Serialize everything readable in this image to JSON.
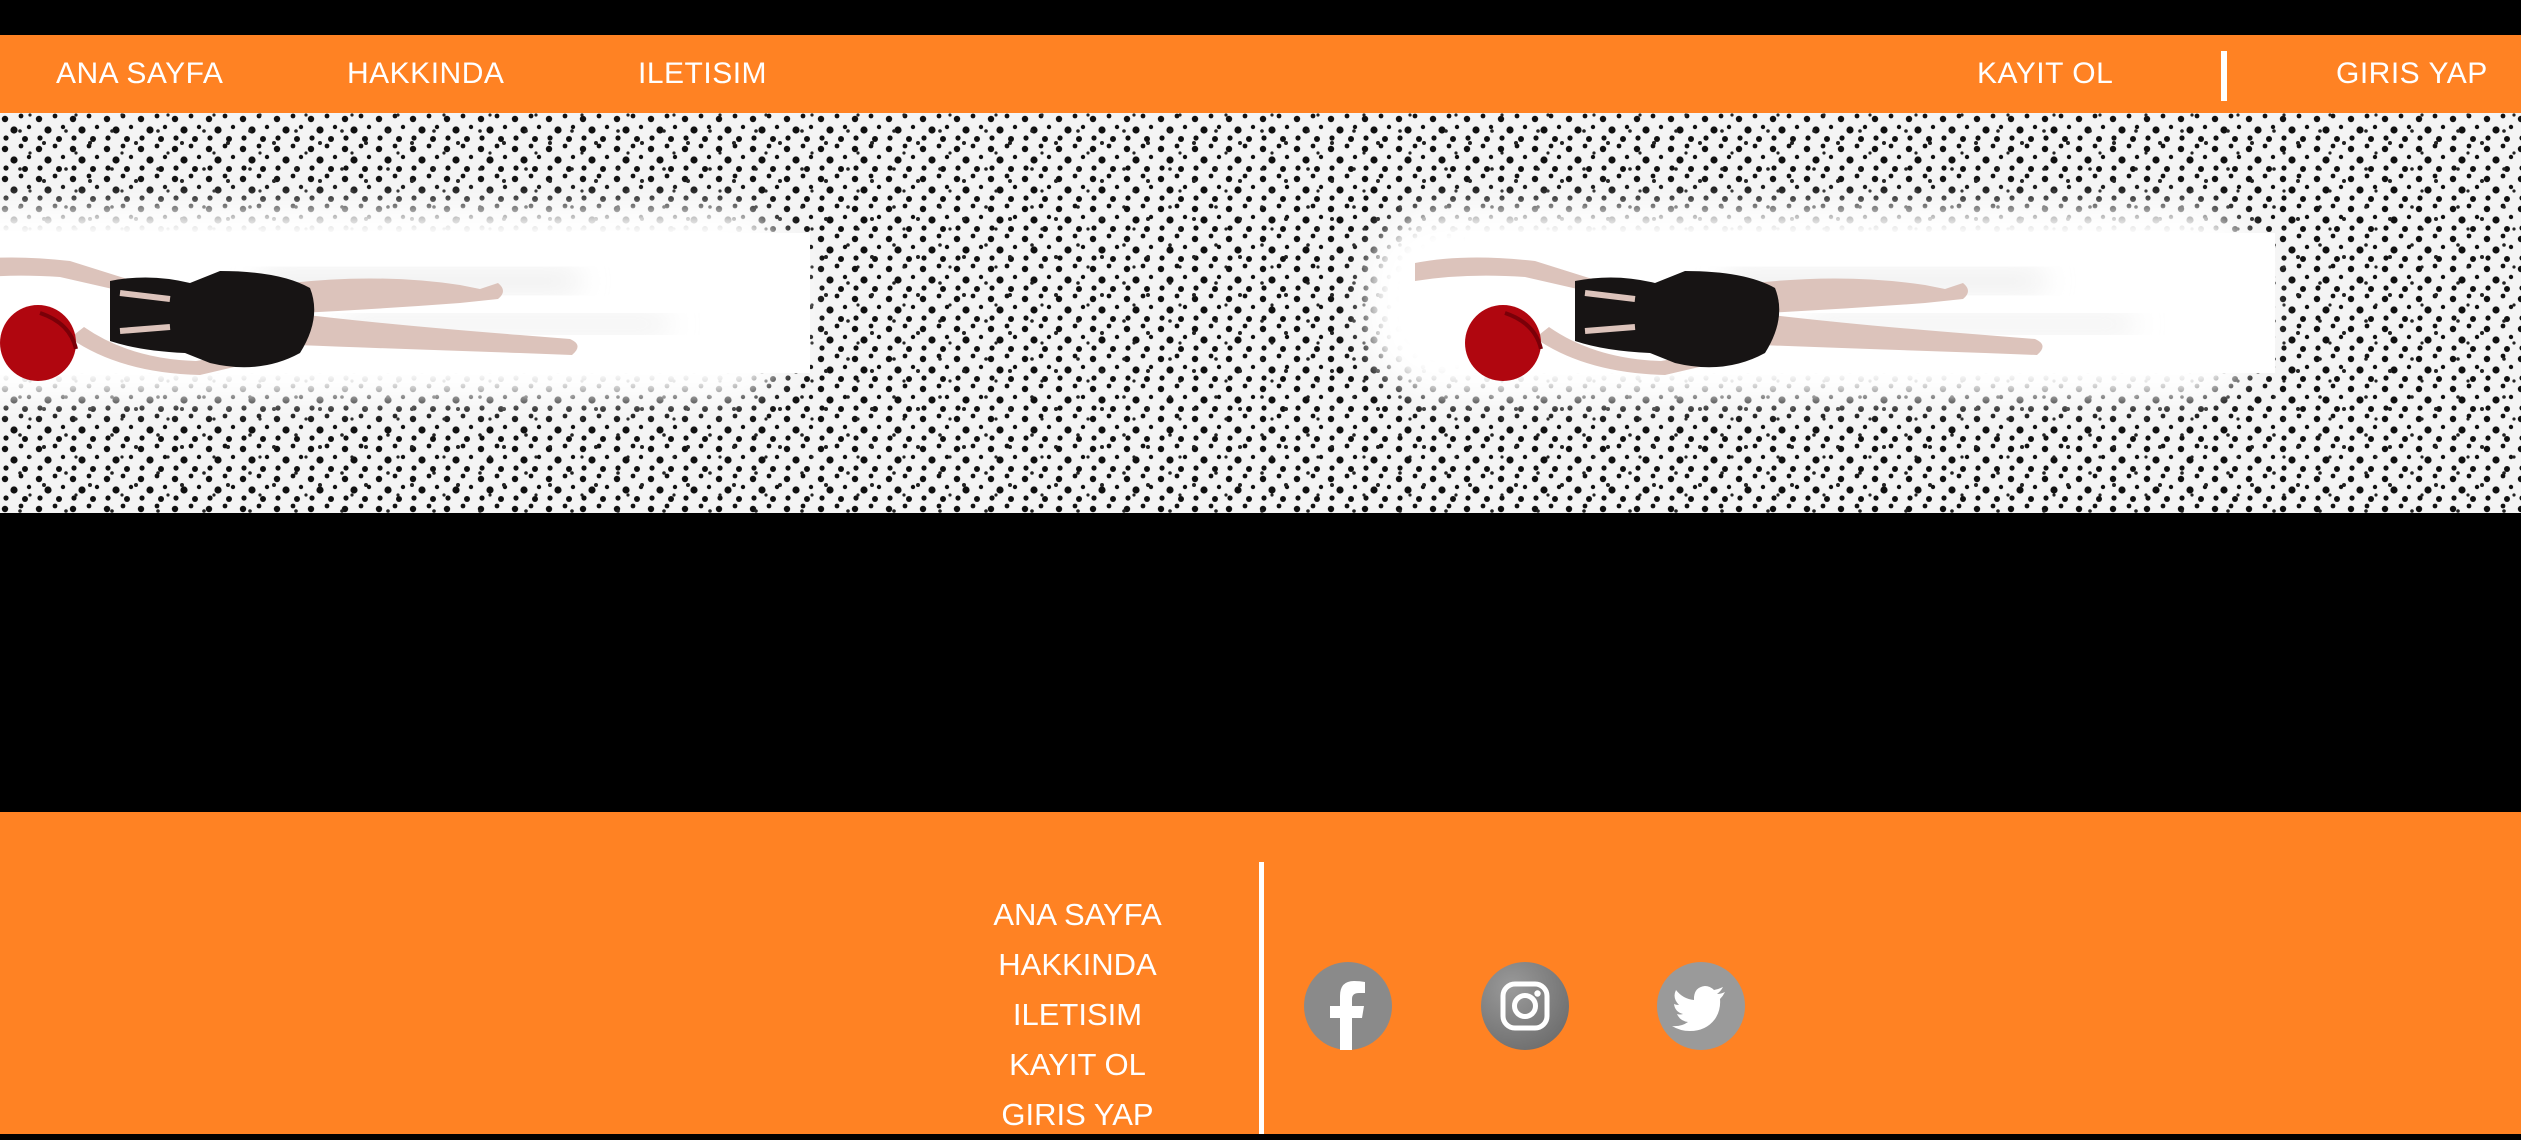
{
  "header": {
    "nav_left": [
      "ANA SAYFA",
      "HAKKINDA",
      "ILETISIM"
    ],
    "register_label": "KAYIT OL",
    "login_label": "GIRIS YAP"
  },
  "banner": {
    "image": "swimmer-on-polka-dot-background"
  },
  "footer": {
    "links": [
      "ANA SAYFA",
      "HAKKINDA",
      "ILETISIM",
      "KAYIT OL",
      "GIRIS YAP"
    ],
    "social": [
      {
        "name": "facebook-icon",
        "letter": "f"
      },
      {
        "name": "instagram-icon"
      },
      {
        "name": "twitter-icon"
      }
    ]
  },
  "colors": {
    "accent": "#ff8223",
    "background": "#000000",
    "text": "#ffffff",
    "social_icon": "#8a8a8a",
    "swim_cap": "#b0060f"
  }
}
